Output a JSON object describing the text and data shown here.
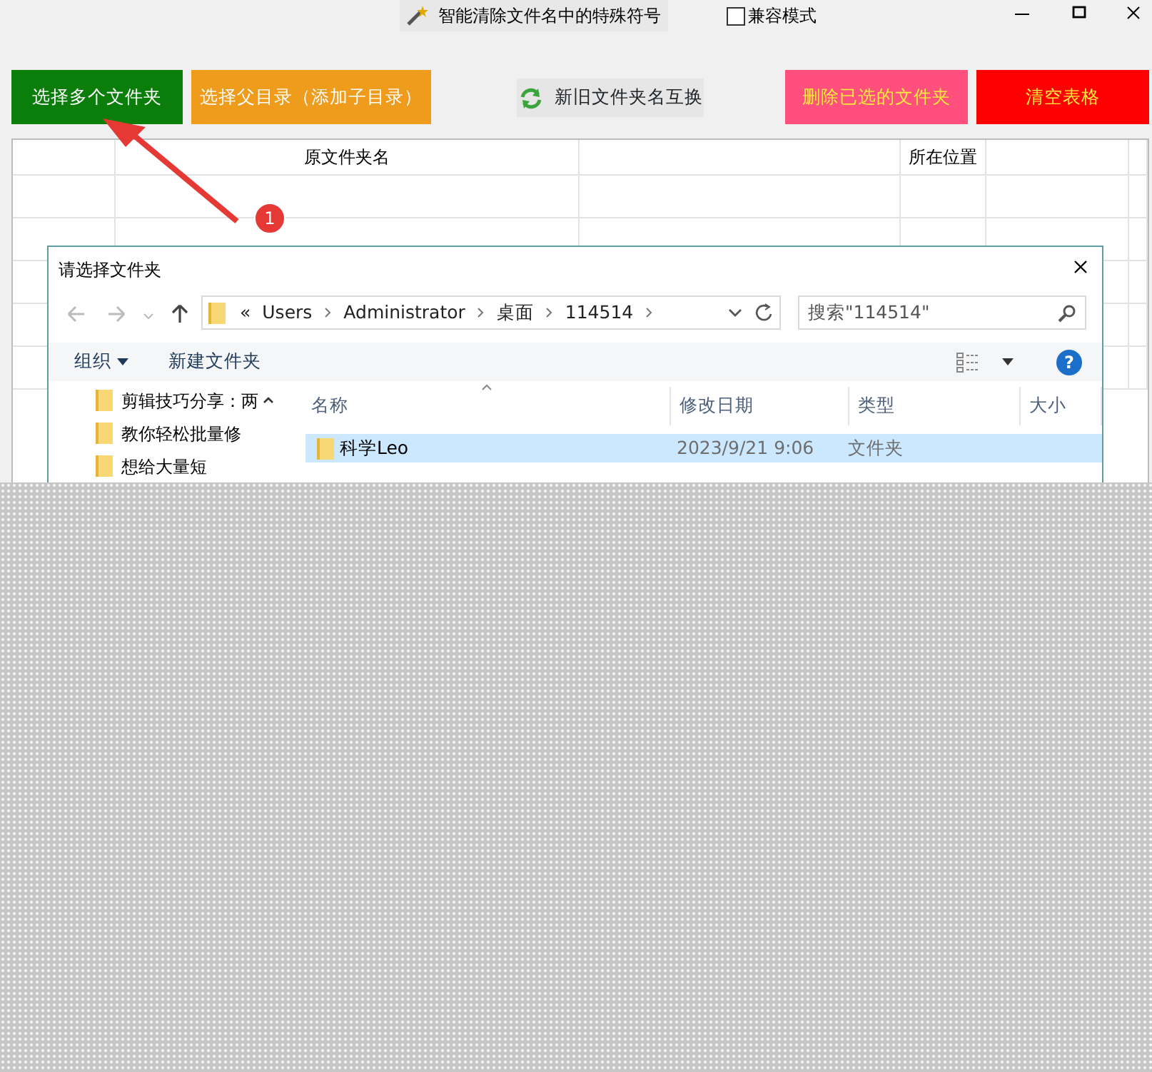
{
  "app": {
    "title": "智能清除文件名中的特殊符号",
    "compat_mode": {
      "label": "兼容模式",
      "checked": false
    }
  },
  "toolbar": [
    {
      "label": "选择多个文件夹",
      "kind": "solid",
      "color": "#0a7d0a"
    },
    {
      "label": "选择父目录（添加子目录）",
      "kind": "solid",
      "color": "#ef9b1b"
    },
    {
      "label": "新旧文件夹名互换",
      "kind": "swap"
    },
    {
      "label": "删除已选的文件夹",
      "kind": "solid",
      "color": "#ff4f7c"
    },
    {
      "label": "清空表格",
      "kind": "solid",
      "color": "#ff0000"
    }
  ],
  "table": {
    "columns": [
      {
        "label": "原文件夹名"
      },
      {
        "label": "所在位置"
      }
    ]
  },
  "annotation": {
    "marker": "1"
  },
  "dialog": {
    "title": "请选择文件夹",
    "overflow_marker": "«",
    "help": "?",
    "breadcrumb": [
      "Users",
      "Administrator",
      "桌面",
      "114514"
    ],
    "search": {
      "placeholder": "搜索\"114514\""
    },
    "commands": [
      "组织",
      "新建文件夹"
    ],
    "tree": [
      "剪辑技巧分享：两",
      "教你轻松批量修",
      "想给大量短"
    ],
    "columns": [
      "名称",
      "修改日期",
      "类型",
      "大小"
    ],
    "rows": [
      {
        "name": "科学Leo",
        "date": "2023/9/21 9:06",
        "type": "文件夹",
        "selected": true
      }
    ]
  }
}
